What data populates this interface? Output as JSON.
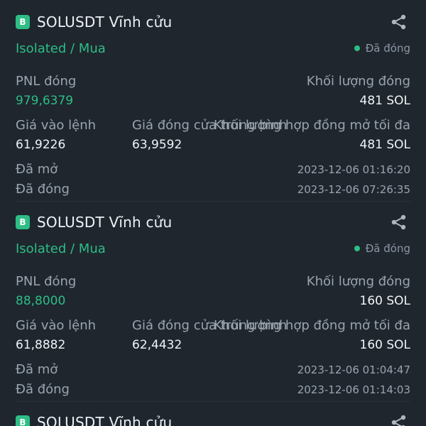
{
  "cards": [
    {
      "badge": "B",
      "title": "SOLUSDT Vĩnh cửu",
      "mode": "Isolated / Mua",
      "status": "Đã đóng",
      "pnl_label": "PNL đóng",
      "pnl_value": "979,6379",
      "volume_label": "Khối lượng đóng",
      "volume_value": "481 SOL",
      "entry_label": "Giá vào lệnh",
      "entry_value": "61,9226",
      "close_label": "Giá đóng cửa trung bình",
      "close_value": "63,9592",
      "max_label": "Khối lượng hợp đồng mở tối đa",
      "max_value": "481 SOL",
      "opened_label": "Đã mở",
      "opened_value": "2023-12-06 01:16:20",
      "closed_label": "Đã đóng",
      "closed_value": "2023-12-06 07:26:35"
    },
    {
      "badge": "B",
      "title": "SOLUSDT Vĩnh cửu",
      "mode": "Isolated / Mua",
      "status": "Đã đóng",
      "pnl_label": "PNL đóng",
      "pnl_value": "88,8000",
      "volume_label": "Khối lượng đóng",
      "volume_value": "160 SOL",
      "entry_label": "Giá vào lệnh",
      "entry_value": "61,8882",
      "close_label": "Giá đóng cửa trung bình",
      "close_value": "62,4432",
      "max_label": "Khối lượng hợp đồng mở tối đa",
      "max_value": "160 SOL",
      "opened_label": "Đã mở",
      "opened_value": "2023-12-06 01:04:47",
      "closed_label": "Đã đóng",
      "closed_value": "2023-12-06 01:14:03"
    },
    {
      "badge": "B",
      "title": "SOLUSDT Vĩnh cửu"
    }
  ],
  "colors": {
    "background": "#1f262e",
    "accent_green": "#2ebd85",
    "muted": "#9aa4af",
    "text": "#f1f4f7"
  },
  "icons": {
    "share": "share-icon"
  }
}
